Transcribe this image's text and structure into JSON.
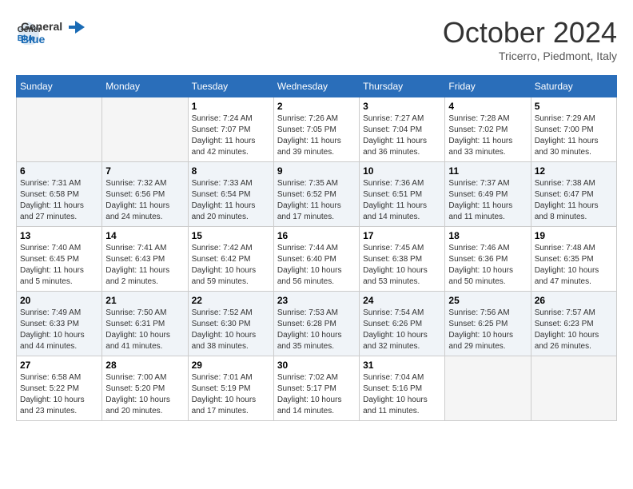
{
  "header": {
    "logo_general": "General",
    "logo_blue": "Blue",
    "month_title": "October 2024",
    "subtitle": "Tricerro, Piedmont, Italy"
  },
  "weekdays": [
    "Sunday",
    "Monday",
    "Tuesday",
    "Wednesday",
    "Thursday",
    "Friday",
    "Saturday"
  ],
  "weeks": [
    [
      {
        "day": "",
        "info": ""
      },
      {
        "day": "",
        "info": ""
      },
      {
        "day": "1",
        "info": "Sunrise: 7:24 AM\nSunset: 7:07 PM\nDaylight: 11 hours and 42 minutes."
      },
      {
        "day": "2",
        "info": "Sunrise: 7:26 AM\nSunset: 7:05 PM\nDaylight: 11 hours and 39 minutes."
      },
      {
        "day": "3",
        "info": "Sunrise: 7:27 AM\nSunset: 7:04 PM\nDaylight: 11 hours and 36 minutes."
      },
      {
        "day": "4",
        "info": "Sunrise: 7:28 AM\nSunset: 7:02 PM\nDaylight: 11 hours and 33 minutes."
      },
      {
        "day": "5",
        "info": "Sunrise: 7:29 AM\nSunset: 7:00 PM\nDaylight: 11 hours and 30 minutes."
      }
    ],
    [
      {
        "day": "6",
        "info": "Sunrise: 7:31 AM\nSunset: 6:58 PM\nDaylight: 11 hours and 27 minutes."
      },
      {
        "day": "7",
        "info": "Sunrise: 7:32 AM\nSunset: 6:56 PM\nDaylight: 11 hours and 24 minutes."
      },
      {
        "day": "8",
        "info": "Sunrise: 7:33 AM\nSunset: 6:54 PM\nDaylight: 11 hours and 20 minutes."
      },
      {
        "day": "9",
        "info": "Sunrise: 7:35 AM\nSunset: 6:52 PM\nDaylight: 11 hours and 17 minutes."
      },
      {
        "day": "10",
        "info": "Sunrise: 7:36 AM\nSunset: 6:51 PM\nDaylight: 11 hours and 14 minutes."
      },
      {
        "day": "11",
        "info": "Sunrise: 7:37 AM\nSunset: 6:49 PM\nDaylight: 11 hours and 11 minutes."
      },
      {
        "day": "12",
        "info": "Sunrise: 7:38 AM\nSunset: 6:47 PM\nDaylight: 11 hours and 8 minutes."
      }
    ],
    [
      {
        "day": "13",
        "info": "Sunrise: 7:40 AM\nSunset: 6:45 PM\nDaylight: 11 hours and 5 minutes."
      },
      {
        "day": "14",
        "info": "Sunrise: 7:41 AM\nSunset: 6:43 PM\nDaylight: 11 hours and 2 minutes."
      },
      {
        "day": "15",
        "info": "Sunrise: 7:42 AM\nSunset: 6:42 PM\nDaylight: 10 hours and 59 minutes."
      },
      {
        "day": "16",
        "info": "Sunrise: 7:44 AM\nSunset: 6:40 PM\nDaylight: 10 hours and 56 minutes."
      },
      {
        "day": "17",
        "info": "Sunrise: 7:45 AM\nSunset: 6:38 PM\nDaylight: 10 hours and 53 minutes."
      },
      {
        "day": "18",
        "info": "Sunrise: 7:46 AM\nSunset: 6:36 PM\nDaylight: 10 hours and 50 minutes."
      },
      {
        "day": "19",
        "info": "Sunrise: 7:48 AM\nSunset: 6:35 PM\nDaylight: 10 hours and 47 minutes."
      }
    ],
    [
      {
        "day": "20",
        "info": "Sunrise: 7:49 AM\nSunset: 6:33 PM\nDaylight: 10 hours and 44 minutes."
      },
      {
        "day": "21",
        "info": "Sunrise: 7:50 AM\nSunset: 6:31 PM\nDaylight: 10 hours and 41 minutes."
      },
      {
        "day": "22",
        "info": "Sunrise: 7:52 AM\nSunset: 6:30 PM\nDaylight: 10 hours and 38 minutes."
      },
      {
        "day": "23",
        "info": "Sunrise: 7:53 AM\nSunset: 6:28 PM\nDaylight: 10 hours and 35 minutes."
      },
      {
        "day": "24",
        "info": "Sunrise: 7:54 AM\nSunset: 6:26 PM\nDaylight: 10 hours and 32 minutes."
      },
      {
        "day": "25",
        "info": "Sunrise: 7:56 AM\nSunset: 6:25 PM\nDaylight: 10 hours and 29 minutes."
      },
      {
        "day": "26",
        "info": "Sunrise: 7:57 AM\nSunset: 6:23 PM\nDaylight: 10 hours and 26 minutes."
      }
    ],
    [
      {
        "day": "27",
        "info": "Sunrise: 6:58 AM\nSunset: 5:22 PM\nDaylight: 10 hours and 23 minutes."
      },
      {
        "day": "28",
        "info": "Sunrise: 7:00 AM\nSunset: 5:20 PM\nDaylight: 10 hours and 20 minutes."
      },
      {
        "day": "29",
        "info": "Sunrise: 7:01 AM\nSunset: 5:19 PM\nDaylight: 10 hours and 17 minutes."
      },
      {
        "day": "30",
        "info": "Sunrise: 7:02 AM\nSunset: 5:17 PM\nDaylight: 10 hours and 14 minutes."
      },
      {
        "day": "31",
        "info": "Sunrise: 7:04 AM\nSunset: 5:16 PM\nDaylight: 10 hours and 11 minutes."
      },
      {
        "day": "",
        "info": ""
      },
      {
        "day": "",
        "info": ""
      }
    ]
  ]
}
